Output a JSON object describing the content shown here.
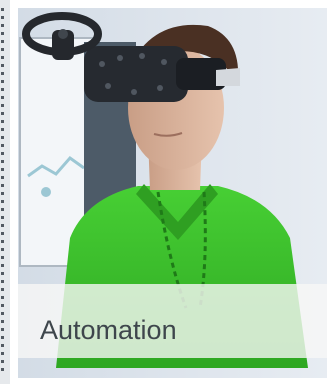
{
  "card": {
    "title": "Automation"
  },
  "icons": {
    "controller": "vr-controller-icon",
    "headset": "vr-headset-icon"
  },
  "colors": {
    "shirt": "#3ec72a",
    "caption_text": "#3e464c"
  }
}
